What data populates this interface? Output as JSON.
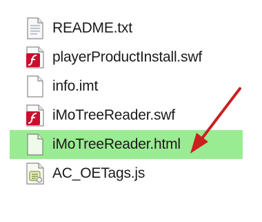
{
  "files": [
    {
      "name": "README.txt",
      "icon": "text-file-icon"
    },
    {
      "name": "playerProductInstall.swf",
      "icon": "flash-file-icon"
    },
    {
      "name": "info.imt",
      "icon": "blank-file-icon"
    },
    {
      "name": "iMoTreeReader.swf",
      "icon": "flash-file-icon"
    },
    {
      "name": "iMoTreeReader.html",
      "icon": "blank-file-icon",
      "highlighted": true
    },
    {
      "name": "AC_OETags.js",
      "icon": "script-file-icon"
    }
  ],
  "colors": {
    "highlight": "#78e66e",
    "arrow": "#cc1f1f",
    "flash_red": "#c8102e"
  }
}
